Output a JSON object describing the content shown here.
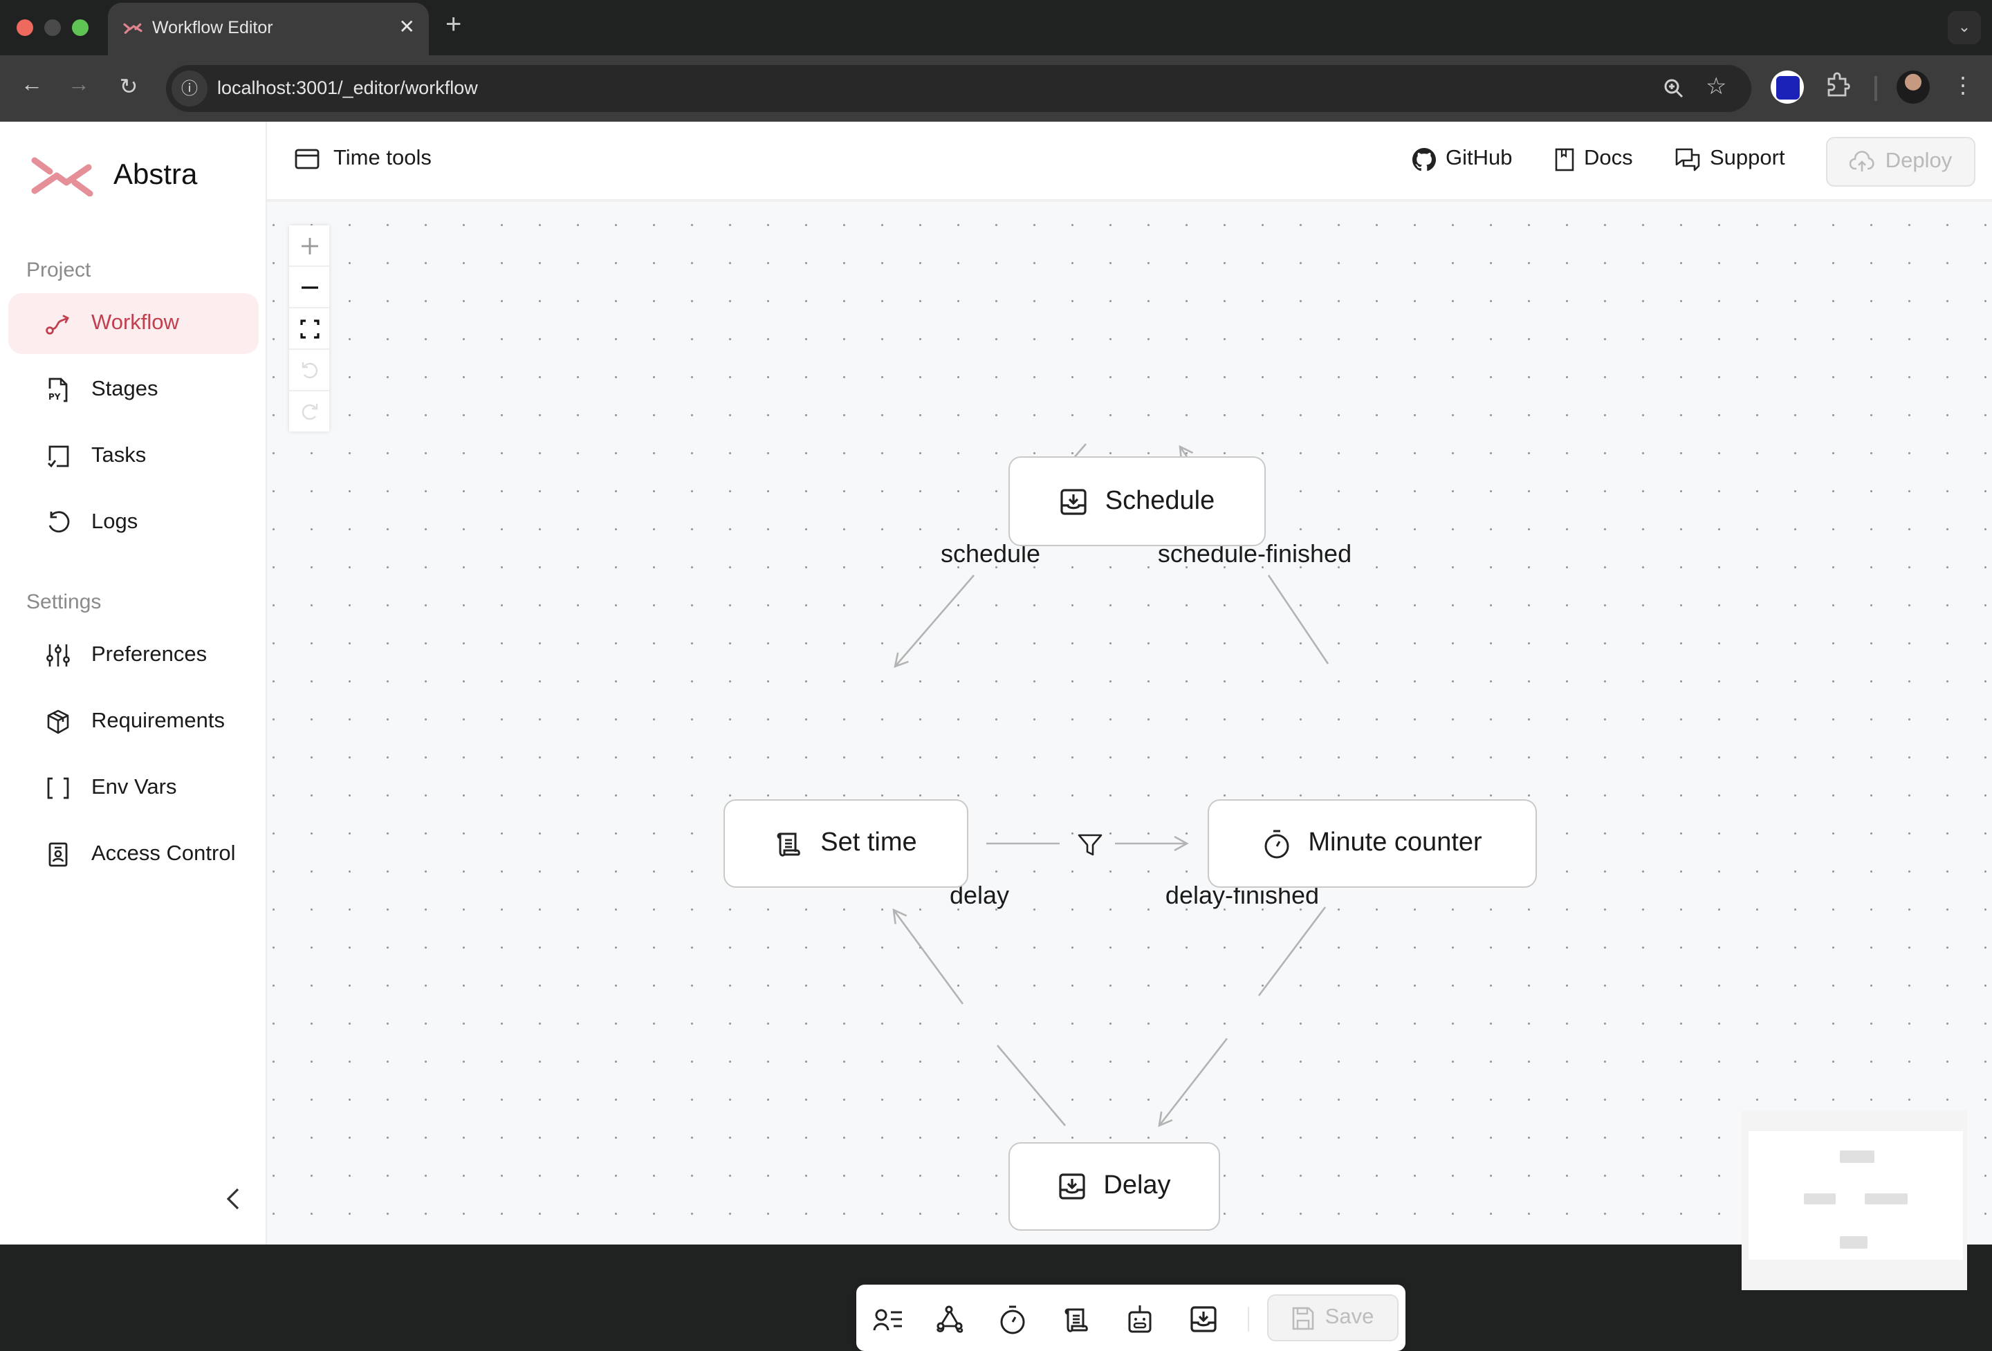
{
  "browser": {
    "tab_title": "Workflow Editor",
    "url": "localhost:3001/_editor/workflow",
    "colors": {
      "close": "#ee6a5f",
      "minimize": "#4a4a4a",
      "maximize": "#5fc454"
    }
  },
  "app": {
    "brand": {
      "name": "Abstra",
      "accent": "#c1404f"
    },
    "sidebar": {
      "sections": [
        {
          "label": "Project",
          "items": [
            {
              "label": "Workflow",
              "icon": "workflow-icon",
              "active": true
            },
            {
              "label": "Stages",
              "icon": "python-file-icon"
            },
            {
              "label": "Tasks",
              "icon": "tasks-icon"
            },
            {
              "label": "Logs",
              "icon": "history-icon"
            }
          ]
        },
        {
          "label": "Settings",
          "items": [
            {
              "label": "Preferences",
              "icon": "sliders-icon"
            },
            {
              "label": "Requirements",
              "icon": "package-icon"
            },
            {
              "label": "Env Vars",
              "icon": "brackets-icon"
            },
            {
              "label": "Access Control",
              "icon": "id-badge-icon"
            }
          ]
        }
      ]
    },
    "header": {
      "project_name": "Time tools",
      "links": [
        {
          "label": "GitHub",
          "icon": "github-icon"
        },
        {
          "label": "Docs",
          "icon": "book-icon"
        },
        {
          "label": "Support",
          "icon": "chat-icon"
        }
      ],
      "deploy_label": "Deploy"
    },
    "workflow": {
      "nodes": [
        {
          "id": "schedule",
          "label": "Schedule",
          "type": "job",
          "icon": "inbox-download-icon"
        },
        {
          "id": "set-time",
          "label": "Set time",
          "type": "script",
          "icon": "scroll-icon"
        },
        {
          "id": "minute-counter",
          "label": "Minute counter",
          "type": "job",
          "icon": "stopwatch-icon"
        },
        {
          "id": "delay",
          "label": "Delay",
          "type": "job",
          "icon": "inbox-download-icon"
        }
      ],
      "edges": [
        {
          "from": "schedule",
          "to": "set-time",
          "label": "schedule"
        },
        {
          "from": "minute-counter",
          "to": "schedule",
          "label": "schedule-finished"
        },
        {
          "from": "set-time",
          "to": "minute-counter",
          "label": "",
          "condition_icon": "filter-icon"
        },
        {
          "from": "delay",
          "to": "set-time",
          "label": "delay"
        },
        {
          "from": "minute-counter",
          "to": "delay",
          "label": "delay-finished"
        }
      ]
    },
    "toolbar": {
      "tools": [
        "form-icon",
        "hook-icon",
        "stopwatch-icon",
        "scroll-icon",
        "robot-icon",
        "inbox-download-icon"
      ],
      "save_label": "Save"
    }
  }
}
